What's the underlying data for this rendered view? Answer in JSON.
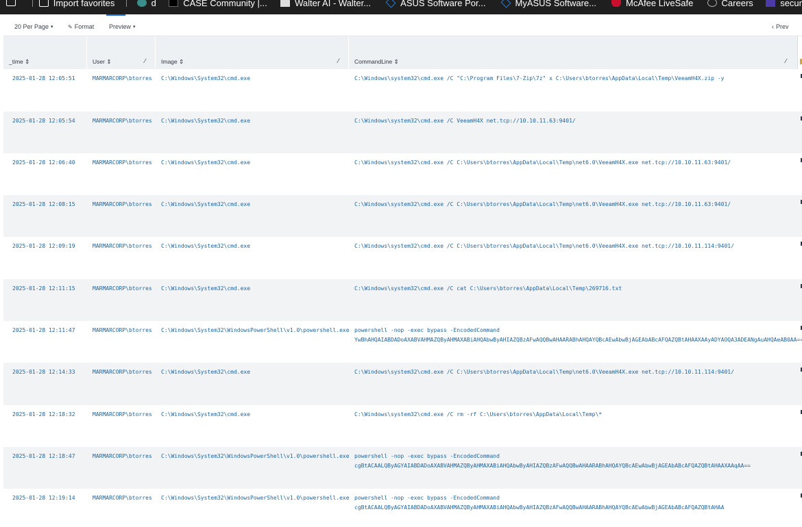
{
  "bookmarks": [
    {
      "label": "Import favorites",
      "icon": "import-icon"
    },
    {
      "label": "d",
      "icon": "globe-icon"
    },
    {
      "label": "CASE Community |...",
      "icon": "case-icon"
    },
    {
      "label": "Walter AI - Walter...",
      "icon": "walter-icon"
    },
    {
      "label": "ASUS Software Por...",
      "icon": "asus-icon"
    },
    {
      "label": "MyASUS Software...",
      "icon": "asus-icon"
    },
    {
      "label": "McAfee LiveSafe",
      "icon": "mcafee-icon"
    },
    {
      "label": "Careers",
      "icon": "careers-icon"
    },
    {
      "label": "secur",
      "icon": "a-icon"
    }
  ],
  "toolbar": {
    "per_page": "20 Per Page",
    "format": "Format",
    "preview": "Preview",
    "prev": "Prev"
  },
  "columns": [
    {
      "label": "_time"
    },
    {
      "label": "User"
    },
    {
      "label": "Image"
    },
    {
      "label": "CommandLine"
    }
  ],
  "rows": [
    {
      "time": "2025-01-28 12:05:51",
      "user": "MARMARCORP\\btorres",
      "image": "C:\\Windows\\System32\\cmd.exe",
      "cmd": "C:\\Windows\\system32\\cmd.exe /C \"C:\\Program Files\\7-Zip\\7z\" x C:\\Users\\btorres\\AppData\\Local\\Temp\\VeeamH4X.zip -y"
    },
    {
      "time": "2025-01-28 12:05:54",
      "user": "MARMARCORP\\btorres",
      "image": "C:\\Windows\\System32\\cmd.exe",
      "cmd": "C:\\Windows\\system32\\cmd.exe /C VeeamH4X net.tcp://10.10.11.63:9401/"
    },
    {
      "time": "2025-01-28 12:06:40",
      "user": "MARMARCORP\\btorres",
      "image": "C:\\Windows\\System32\\cmd.exe",
      "cmd": "C:\\Windows\\system32\\cmd.exe /C C:\\Users\\btorres\\AppData\\Local\\Temp\\net6.0\\VeeamH4X.exe net.tcp://10.10.11.63:9401/"
    },
    {
      "time": "2025-01-28 12:08:15",
      "user": "MARMARCORP\\btorres",
      "image": "C:\\Windows\\System32\\cmd.exe",
      "cmd": "C:\\Windows\\system32\\cmd.exe /C C:\\Users\\btorres\\AppData\\Local\\Temp\\net6.0\\VeeamH4X.exe net.tcp://10.10.11.63:9401/"
    },
    {
      "time": "2025-01-28 12:09:19",
      "user": "MARMARCORP\\btorres",
      "image": "C:\\Windows\\System32\\cmd.exe",
      "cmd": "C:\\Windows\\system32\\cmd.exe /C C:\\Users\\btorres\\AppData\\Local\\Temp\\net6.0\\VeeamH4X.exe net.tcp://10.10.11.114:9401/"
    },
    {
      "time": "2025-01-28 12:11:15",
      "user": "MARMARCORP\\btorres",
      "image": "C:\\Windows\\System32\\cmd.exe",
      "cmd": "C:\\Windows\\system32\\cmd.exe /C cat C:\\Users\\btorres\\AppData\\Local\\Temp\\269716.txt"
    },
    {
      "time": "2025-01-28 12:11:47",
      "user": "MARMARCORP\\btorres",
      "image": "C:\\Windows\\System32\\WindowsPowerShell\\v1.0\\powershell.exe",
      "cmd": "powershell -nop -exec bypass -EncodedCommand\nYwBhAHQAIABDADoAXABVAHMAZQByAHMAXABiAHQAbwByAHIAZQBzAFwAQQBwAHAARABhAHQAYQBcAEwAbwBjAGEAbABcAFQAZQBtAHAAXAAyADYAOQA3ADEANgAuAHQAeAB0AA=="
    },
    {
      "time": "2025-01-28 12:14:33",
      "user": "MARMARCORP\\btorres",
      "image": "C:\\Windows\\System32\\cmd.exe",
      "cmd": "C:\\Windows\\system32\\cmd.exe /C C:\\Users\\btorres\\AppData\\Local\\Temp\\net6.0\\VeeamH4X.exe net.tcp://10.10.11.114:9401/"
    },
    {
      "time": "2025-01-28 12:18:32",
      "user": "MARMARCORP\\btorres",
      "image": "C:\\Windows\\System32\\cmd.exe",
      "cmd": "C:\\Windows\\system32\\cmd.exe /C rm -rf C:\\Users\\btorres\\AppData\\Local\\Temp\\*"
    },
    {
      "time": "2025-01-28 12:18:47",
      "user": "MARMARCORP\\btorres",
      "image": "C:\\Windows\\System32\\WindowsPowerShell\\v1.0\\powershell.exe",
      "cmd": "powershell -nop -exec bypass -EncodedCommand\ncgBtACAALQByAGYAIABDADoAXABVAHMAZQByAHMAXABiAHQAbwByAHIAZQBzAFwAQQBwAHAARABhAHQAYQBcAEwAbwBjAGEAbABcAFQAZQBtAHAAXAAqAA=="
    },
    {
      "time": "2025-01-28 12:19:14",
      "user": "MARMARCORP\\btorres",
      "image": "C:\\Windows\\System32\\WindowsPowerShell\\v1.0\\powershell.exe",
      "cmd": "powershell -nop -exec bypass -EncodedCommand\ncgBtACAALQByAGYAIABDADoAXABVAHMAZQByAHMAXABiAHQAbwByAHIAZQBzAFwAQQBwAHAARABhAHQAYQBcAEwAbwBjAGEAbABcAFQAZQBtAHAA"
    }
  ]
}
